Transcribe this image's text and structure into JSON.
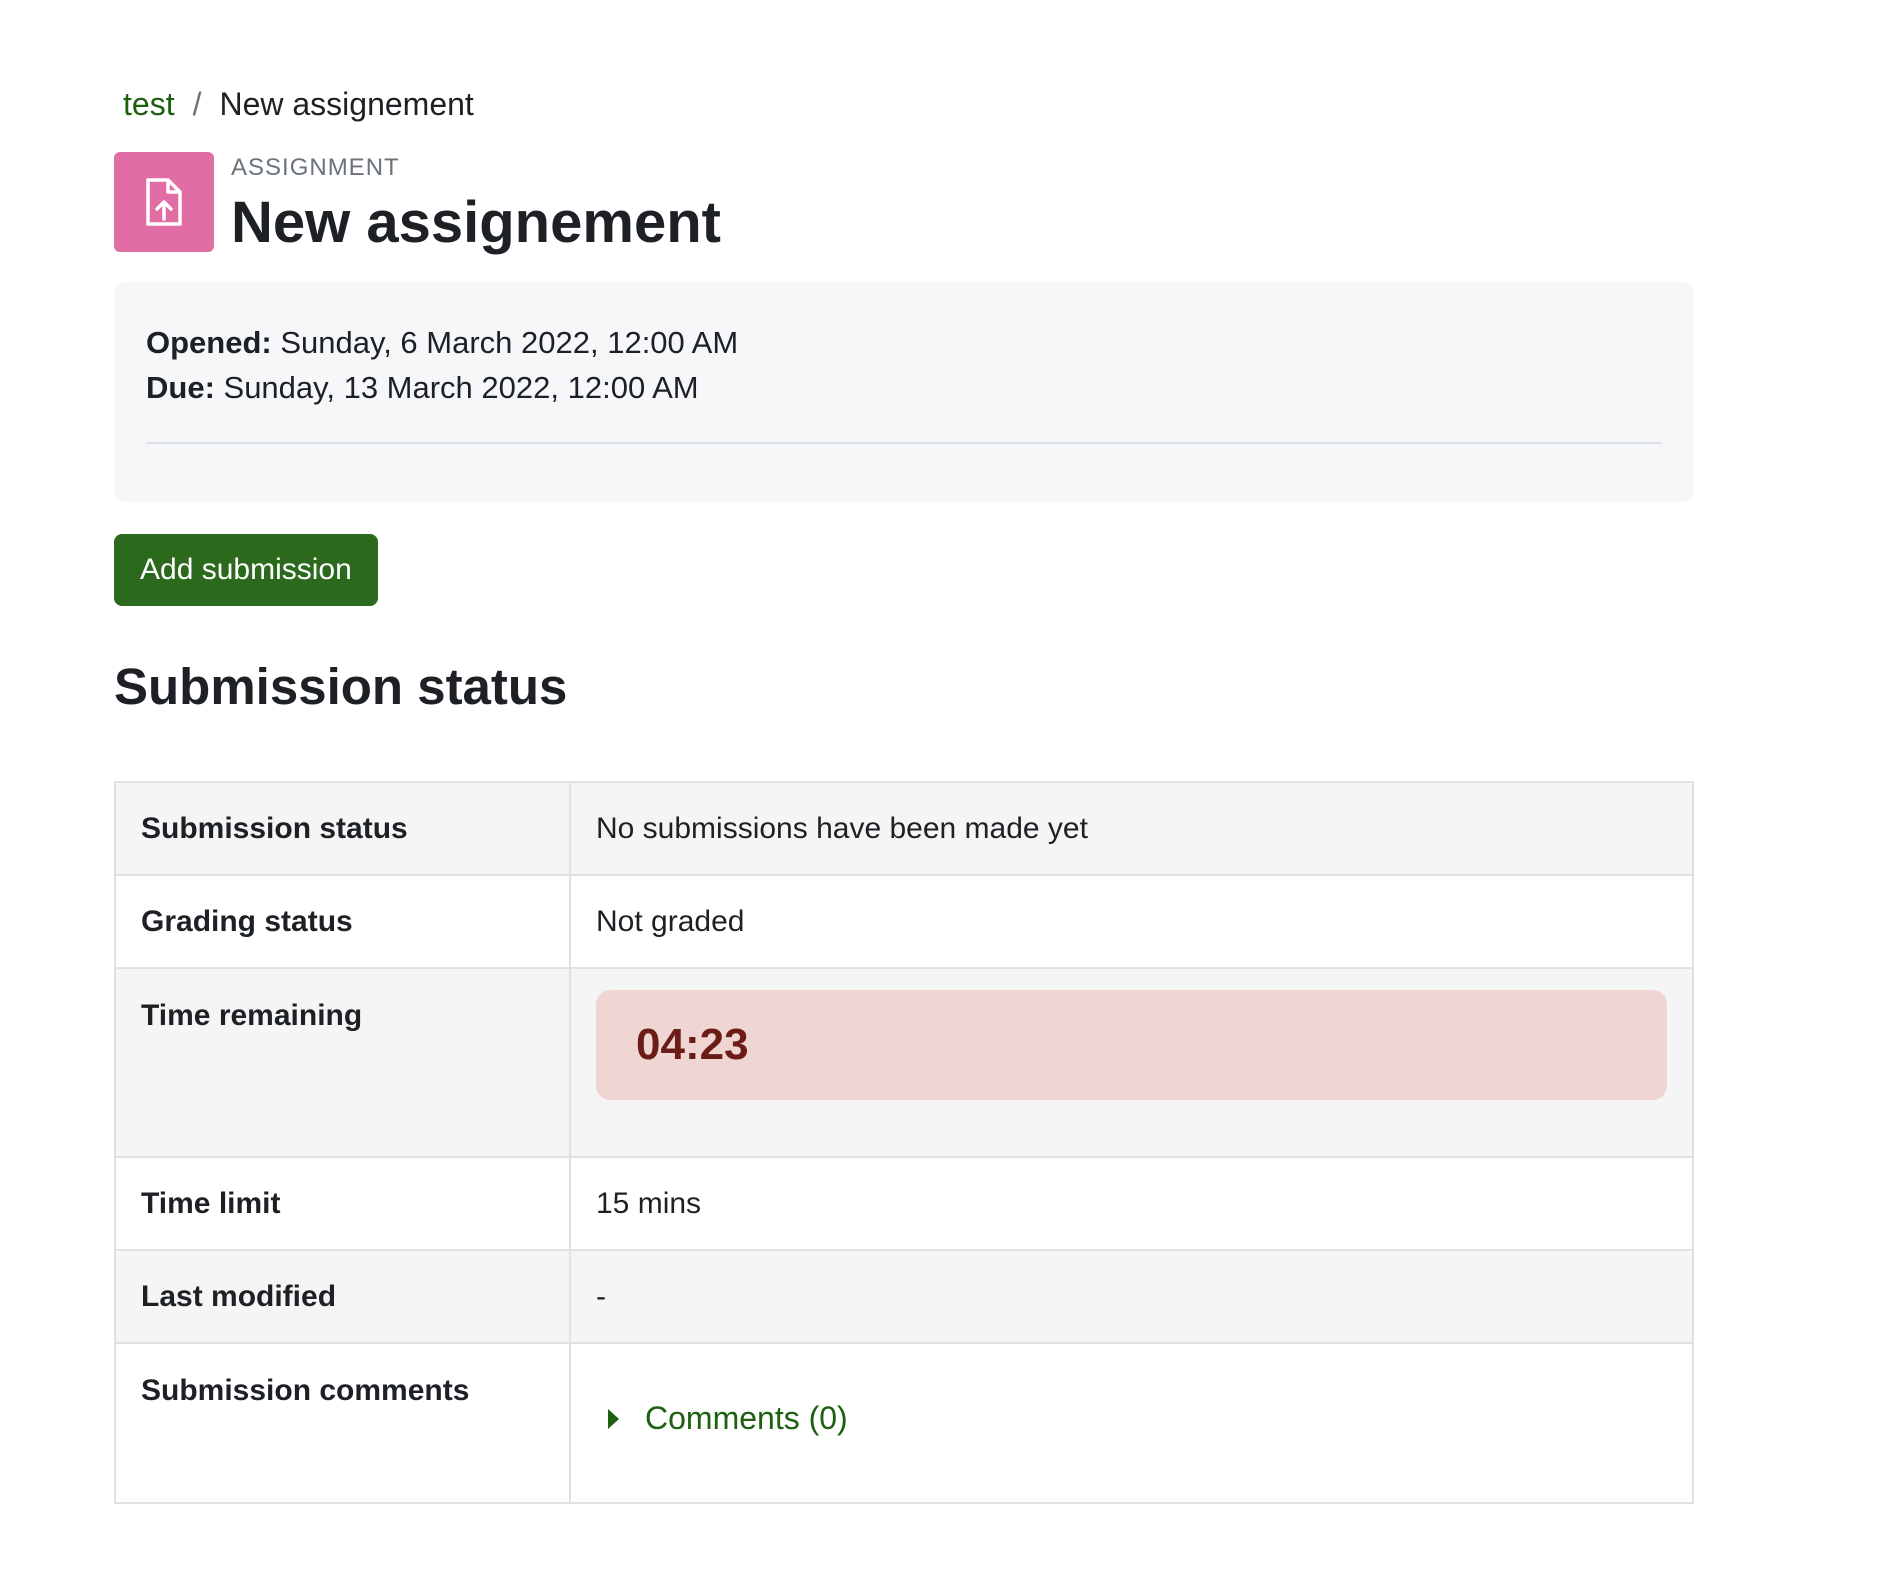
{
  "breadcrumb": {
    "course_link": "test",
    "separator": "/",
    "current": "New assignement"
  },
  "header": {
    "icon": "file-upload-icon",
    "activity_type": "ASSIGNMENT",
    "title": "New assignement",
    "icon_color": "#e06da3"
  },
  "dates": {
    "opened_label": "Opened:",
    "opened_value": "Sunday, 6 March 2022, 12:00 AM",
    "due_label": "Due:",
    "due_value": "Sunday, 13 March 2022, 12:00 AM"
  },
  "actions": {
    "add_submission_label": "Add submission",
    "button_color": "#2b6a1c"
  },
  "submission_status": {
    "heading": "Submission status",
    "rows": [
      {
        "label": "Submission status",
        "value": "No submissions have been made yet"
      },
      {
        "label": "Grading status",
        "value": "Not graded"
      },
      {
        "label": "Time remaining",
        "value": "04:23"
      },
      {
        "label": "Time limit",
        "value": "15 mins"
      },
      {
        "label": "Last modified",
        "value": "-"
      },
      {
        "label": "Submission comments",
        "value": "Comments (0)"
      }
    ]
  },
  "colors": {
    "link": "#1c6010",
    "timer_background": "#efd6d3",
    "timer_text": "#6b1c17"
  }
}
